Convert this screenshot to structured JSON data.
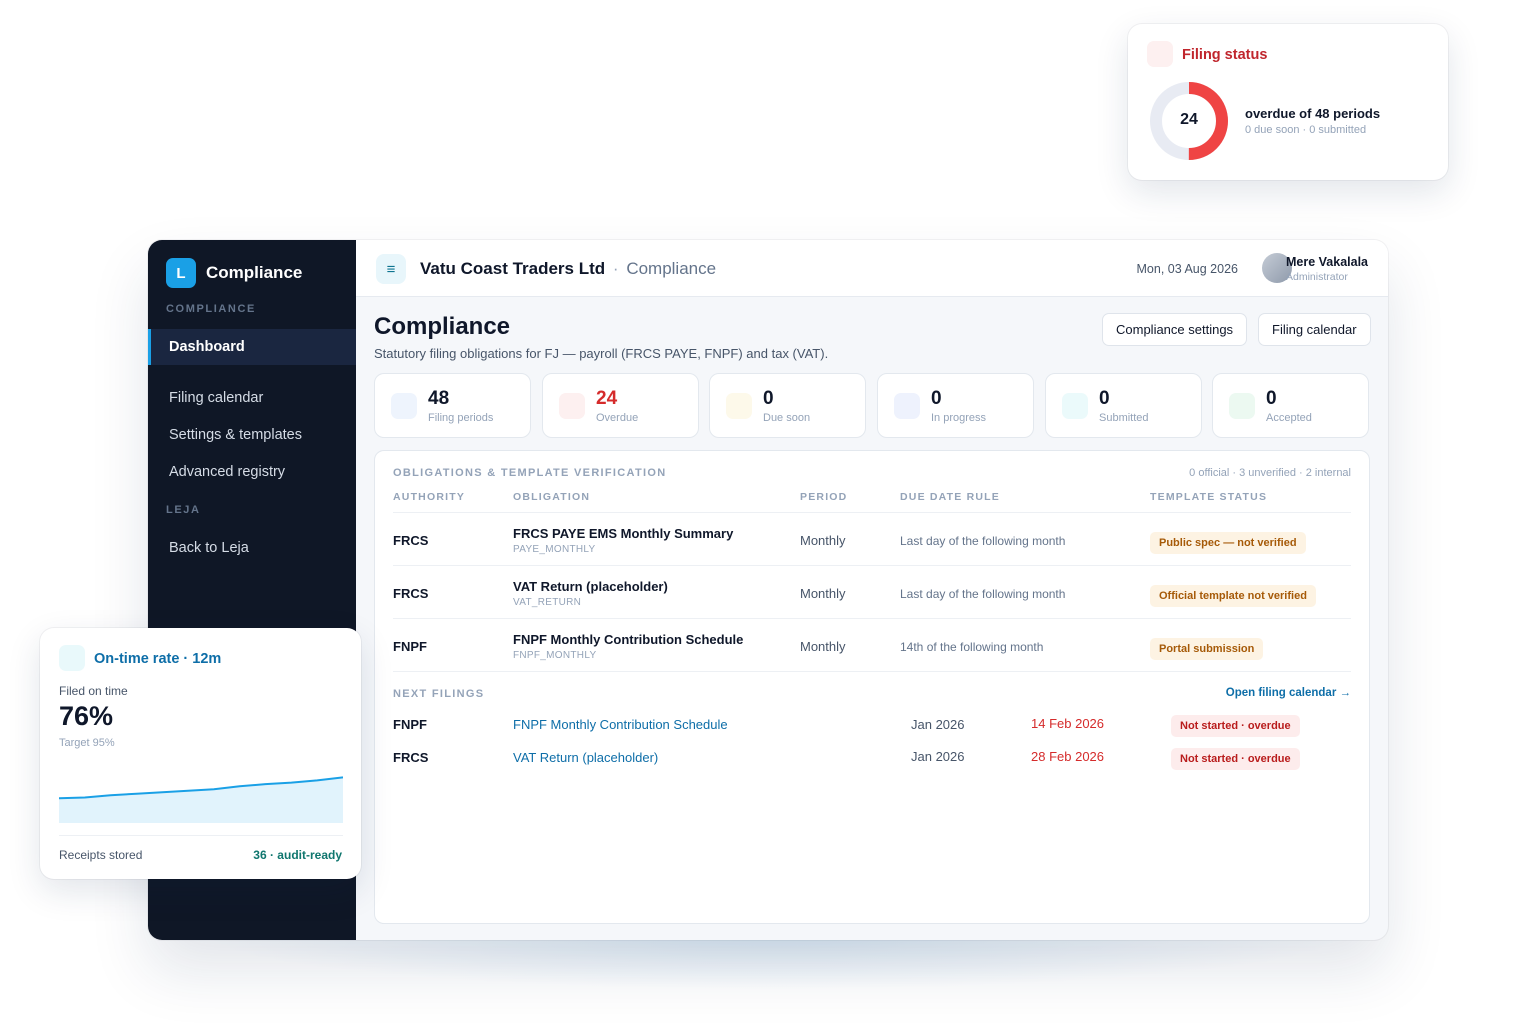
{
  "app": {
    "brand_letter": "L",
    "brand_name": "Compliance",
    "sidebar": {
      "section_compliance": "COMPLIANCE",
      "items": [
        {
          "label": "Dashboard"
        },
        {
          "label": "Filing calendar"
        },
        {
          "label": "Settings & templates"
        },
        {
          "label": "Advanced registry"
        }
      ],
      "section_leja": "LEJA",
      "back_label": "Back to Leja"
    },
    "header": {
      "menu_glyph": "≡",
      "company": "Vatu Coast Traders Ltd",
      "separator": "·",
      "page": "Compliance",
      "date": "Mon, 03 Aug 2026",
      "user_name": "Mere Vakalala",
      "user_role": "Administrator"
    },
    "page": {
      "title": "Compliance",
      "subtitle": "Statutory filing obligations for FJ — payroll (FRCS PAYE, FNPF) and tax (VAT).",
      "settings_button": "Compliance settings",
      "calendar_button": "Filing calendar"
    },
    "stats": [
      {
        "value": "48",
        "label": "Filing periods",
        "icon_color": "#eef4fd",
        "value_color": "#0f172a"
      },
      {
        "value": "24",
        "label": "Overdue",
        "icon_color": "#fdf0f0",
        "value_color": "#d52b2b"
      },
      {
        "value": "0",
        "label": "Due soon",
        "icon_color": "#fdf9ea",
        "value_color": "#0f172a"
      },
      {
        "value": "0",
        "label": "In progress",
        "icon_color": "#eef2fd",
        "value_color": "#0f172a"
      },
      {
        "value": "0",
        "label": "Submitted",
        "icon_color": "#ebfafb",
        "value_color": "#0f172a"
      },
      {
        "value": "0",
        "label": "Accepted",
        "icon_color": "#ecf9f1",
        "value_color": "#0f172a"
      }
    ],
    "obligations": {
      "heading": "OBLIGATIONS & TEMPLATE VERIFICATION",
      "meta": "0 official · 3 unverified · 2 internal",
      "columns": [
        "AUTHORITY",
        "OBLIGATION",
        "PERIOD",
        "DUE DATE RULE",
        "TEMPLATE STATUS"
      ],
      "rows": [
        {
          "authority": "FRCS",
          "name": "FRCS PAYE EMS Monthly Summary",
          "code": "PAYE_MONTHLY",
          "period": "Monthly",
          "rule": "Last day of the following month",
          "status": "Public spec — not verified"
        },
        {
          "authority": "FRCS",
          "name": "VAT Return (placeholder)",
          "code": "VAT_RETURN",
          "period": "Monthly",
          "rule": "Last day of the following month",
          "status": "Official template not verified"
        },
        {
          "authority": "FNPF",
          "name": "FNPF Monthly Contribution Schedule",
          "code": "FNPF_MONTHLY",
          "period": "Monthly",
          "rule": "14th of the following month",
          "status": "Portal submission"
        }
      ]
    },
    "next_filings": {
      "heading": "NEXT FILINGS",
      "link": "Open filing calendar →",
      "rows": [
        {
          "authority": "FNPF",
          "name": "FNPF Monthly Contribution Schedule",
          "period": "Jan 2026",
          "due": "14 Feb 2026",
          "status": "Not started · overdue"
        },
        {
          "authority": "FRCS",
          "name": "VAT Return (placeholder)",
          "period": "Jan 2026",
          "due": "28 Feb 2026",
          "status": "Not started · overdue"
        }
      ]
    }
  },
  "filing_status_card": {
    "title": "Filing status",
    "count": "24",
    "headline": "overdue of 48 periods",
    "detail": "0 due soon · 0 submitted",
    "overdue_fraction": 0.5,
    "ring_color": "#ef4444",
    "track_color": "#e8ebf3"
  },
  "ontime_card": {
    "title": "On-time rate · 12m",
    "label": "Filed on time",
    "rate": "76%",
    "target": "Target 95%",
    "footer_label": "Receipts stored",
    "footer_value": "36 · audit-ready",
    "trend": [
      28,
      29,
      32,
      34,
      36,
      38,
      40,
      44,
      47,
      49,
      52,
      56
    ],
    "line_color": "#1aa0e6"
  },
  "colors": {
    "accent": "#1aa0e6",
    "sidebar_bg": "#0f1726",
    "overdue": "#d52b2b",
    "link": "#0e6ea8"
  }
}
